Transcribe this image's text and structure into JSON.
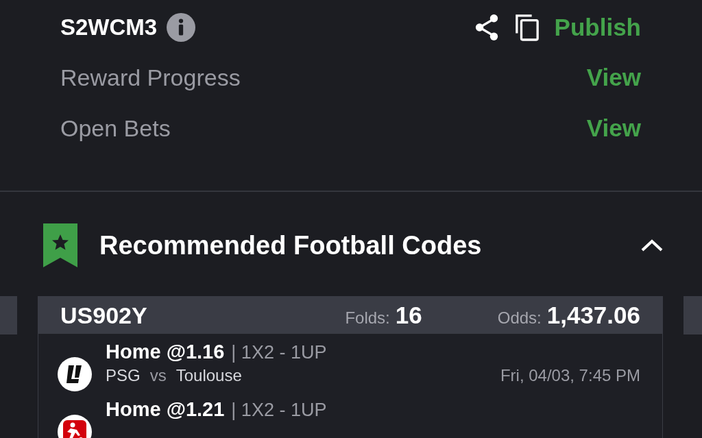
{
  "header": {
    "code": "S2WCM3",
    "publish": "Publish"
  },
  "links": [
    {
      "label": "Reward Progress",
      "action": "View"
    },
    {
      "label": "Open Bets",
      "action": "View"
    }
  ],
  "section": {
    "title": "Recommended Football Codes",
    "expanded": true
  },
  "card": {
    "code": "US902Y",
    "folds_label": "Folds:",
    "folds": "16",
    "odds_label": "Odds:",
    "odds": "1,437.06",
    "selections": [
      {
        "kind": "ligue",
        "pick": "Home @1.16",
        "market": "| 1X2 - 1UP",
        "home": "PSG",
        "vs": "vs",
        "away": "Toulouse",
        "time": "Fri, 04/03, 7:45 PM"
      },
      {
        "kind": "bundesliga",
        "pick": "Home @1.21",
        "market": "| 1X2 - 1UP"
      }
    ]
  }
}
